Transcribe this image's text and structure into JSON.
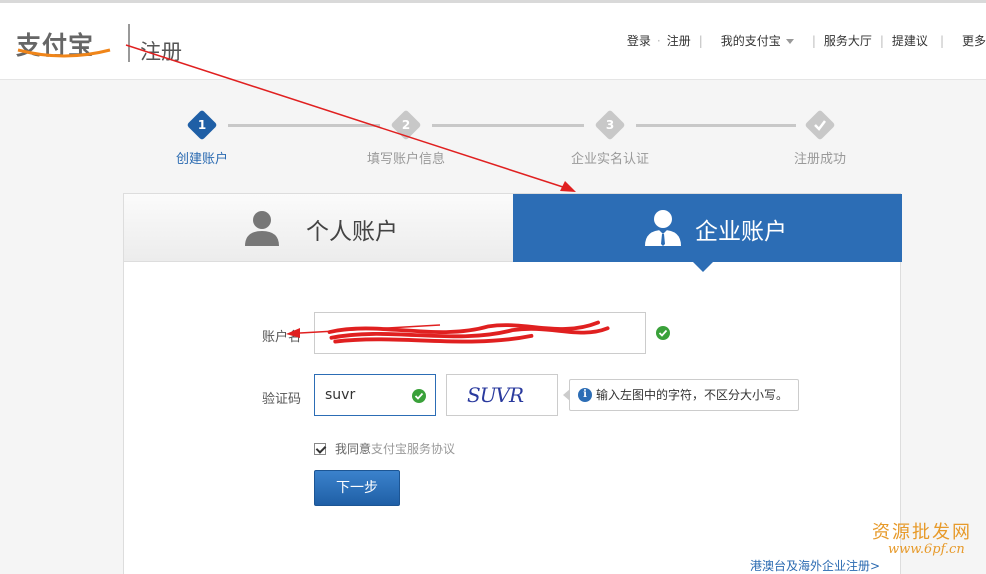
{
  "header": {
    "logo_text": "支付宝",
    "page_title": "注册",
    "nav": {
      "login": "登录",
      "register": "注册",
      "my_alipay": "我的支付宝",
      "service_hall": "服务大厅",
      "suggestion": "提建议",
      "more": "更多"
    }
  },
  "steps": [
    {
      "number": "1",
      "label": "创建账户"
    },
    {
      "number": "2",
      "label": "填写账户信息"
    },
    {
      "number": "3",
      "label": "企业实名认证"
    },
    {
      "number": "",
      "label": "注册成功"
    }
  ],
  "tabs": {
    "personal": "个人账户",
    "enterprise": "企业账户"
  },
  "form": {
    "account_label": "账户名",
    "captcha_label": "验证码",
    "captcha_value": "suvr",
    "captcha_image_text": "SUVR",
    "captcha_tip": "输入左图中的字符，不区分大小写。",
    "agree_prefix": "我同意",
    "agree_link": "支付宝服务协议",
    "next_button": "下一步"
  },
  "footer_link": "港澳台及海外企业注册>",
  "watermark": {
    "title": "资源批发网",
    "url": "www.6pf.cn"
  },
  "colors": {
    "primary": "#2c6db5",
    "active_step": "#1f5fa6",
    "inactive_step": "#c8c8c8",
    "ok": "#3aa13a",
    "annotation": "#e02020"
  }
}
